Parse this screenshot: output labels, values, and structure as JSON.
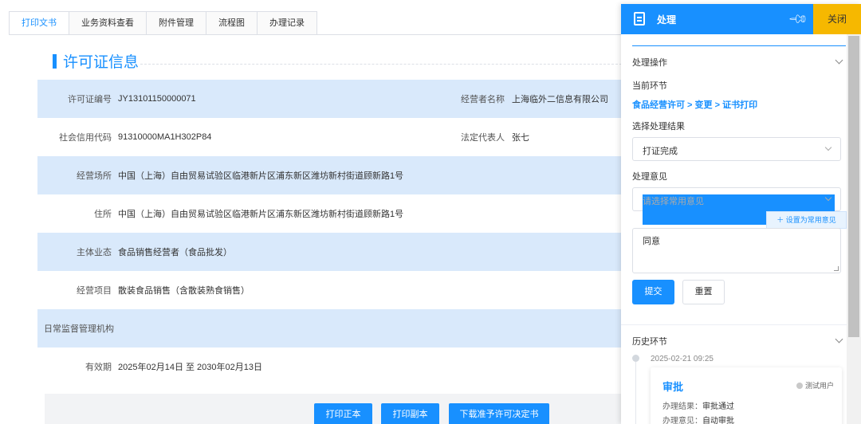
{
  "tabs": [
    "打印文书",
    "业务资料查看",
    "附件管理",
    "流程图",
    "办理记录"
  ],
  "section_title": "许可证信息",
  "rows": [
    {
      "label": "许可证编号",
      "value": "JY13101150000071",
      "label2": "经营者名称",
      "value2": "上海临外二信息有限公司"
    },
    {
      "label": "社会信用代码",
      "value": "91310000MA1H302P84",
      "label2": "法定代表人",
      "value2": "张七"
    },
    {
      "label": "经营场所",
      "value": "中国（上海）自由贸易试验区临港新片区浦东新区潍坊新村街道顾新路1号"
    },
    {
      "label": "住所",
      "value": "中国（上海）自由贸易试验区临港新片区浦东新区潍坊新村街道顾新路1号"
    },
    {
      "label": "主体业态",
      "value": "食品销售经营者（食品批发）"
    },
    {
      "label": "经营项目",
      "value": "散装食品销售（含散装熟食销售）"
    },
    {
      "label": "日常监督管理机构",
      "value": ""
    },
    {
      "label": "有效期",
      "value": "2025年02月14日  至  2030年02月13日"
    }
  ],
  "buttons": {
    "print_original": "打印正本",
    "print_copy": "打印副本",
    "download_decision": "下载准予许可决定书"
  },
  "panel": {
    "title": "处理",
    "close": "关闭",
    "section_ops": "处理操作",
    "current_step_label": "当前环节",
    "current_step_value": "食品经营许可 > 变更 > 证书打印",
    "result_label": "选择处理结果",
    "result_value": "打证完成",
    "opinion_label": "处理意见",
    "opinion_placeholder": "请选择常用意见",
    "set_common": "设置为常用意见",
    "opinion_text": "同意",
    "submit": "提交",
    "reset": "重置",
    "history_label": "历史环节",
    "history": {
      "time": "2025-02-21 09:25",
      "title": "审批",
      "user": "测试用户",
      "result_label": "办理结果：",
      "result_value": "审批通过",
      "opinion_label": "办理意见：",
      "opinion_value": "自动审批"
    }
  },
  "colors": {
    "accent": "#1890ff",
    "row_blue": "#d9e9fb",
    "close_bg": "#f6b800"
  },
  "icons": [
    "document-icon",
    "pin-icon",
    "chevron-down-icon",
    "plus-icon",
    "user-icon"
  ]
}
